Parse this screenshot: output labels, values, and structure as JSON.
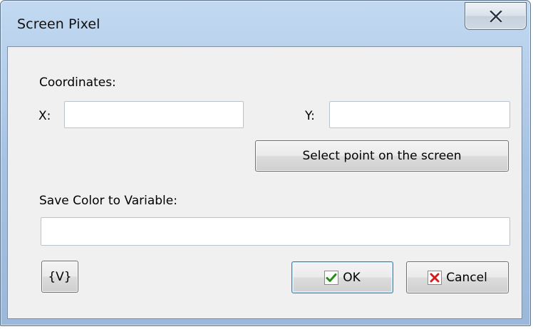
{
  "window": {
    "title": "Screen Pixel",
    "close_label": "close"
  },
  "coordinates": {
    "label": "Coordinates:",
    "x_label": "X:",
    "x_value": "",
    "y_label": "Y:",
    "y_value": "",
    "select_point_label": "Select point on the screen"
  },
  "save_color": {
    "label": "Save Color to Variable:",
    "value": ""
  },
  "buttons": {
    "variables_label": "{V}",
    "ok_label": "OK",
    "cancel_label": "Cancel"
  },
  "icons": {
    "close": "close-icon",
    "ok": "checkmark-icon",
    "cancel": "cross-icon"
  },
  "colors": {
    "ok_check": "#2a8a1d",
    "cancel_cross": "#d11f1f",
    "title_bar": "#a7c2e2"
  }
}
